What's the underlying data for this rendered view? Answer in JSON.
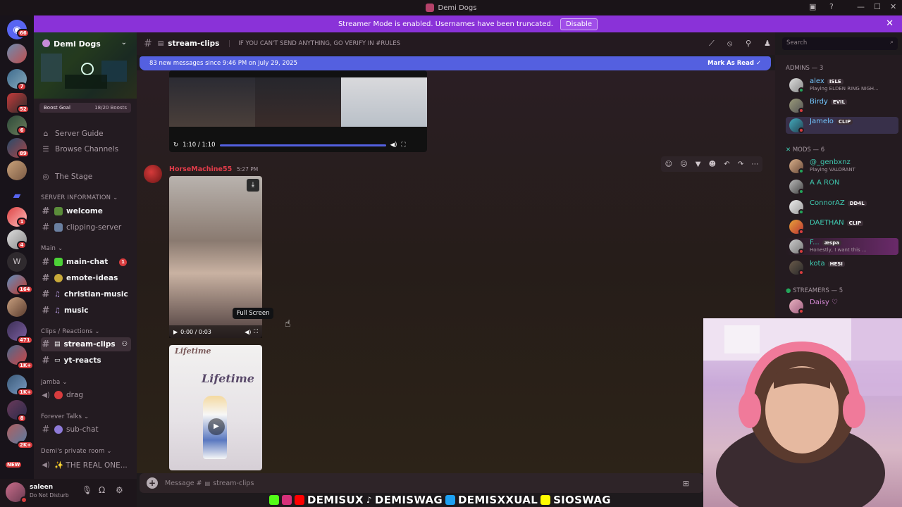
{
  "window": {
    "title": "Demi Dogs"
  },
  "banner": {
    "text": "Streamer Mode is enabled. Usernames have been truncated.",
    "button": "Disable"
  },
  "guilds": [
    {
      "badge": "66"
    },
    {
      "badge": ""
    },
    {
      "badge": "7"
    },
    {
      "badge": "52"
    },
    {
      "badge": "6"
    },
    {
      "badge": "89"
    },
    {
      "badge": ""
    },
    {
      "badge": ""
    },
    {
      "badge": "1"
    },
    {
      "badge": "4"
    },
    {
      "badge": "W"
    },
    {
      "badge": "164"
    },
    {
      "badge": ""
    },
    {
      "badge": "471"
    },
    {
      "badge": "1K+"
    },
    {
      "badge": "1K+"
    },
    {
      "badge": "8"
    },
    {
      "badge": "2K+"
    },
    {
      "badge": "NEW"
    }
  ],
  "server": {
    "name": "Demi Dogs",
    "boost_goal": "Boost Goal",
    "boost_count": "18/20 Boosts",
    "links": [
      "Server Guide",
      "Browse Channels",
      "The Stage"
    ],
    "categories": {
      "server_info": "SERVER INFORMATION",
      "main": "Main",
      "clips": "Clips / Reactions",
      "jamba": "jamba",
      "forever": "Forever Talks",
      "demi_room": "Demi's private room"
    },
    "channels": {
      "welcome": "welcome",
      "clipping": "clipping-server",
      "main_chat": "main-chat",
      "main_chat_badge": "1",
      "emote_ideas": "emote-ideas",
      "christian_music": "christian-music",
      "music": "music",
      "stream_clips": "stream-clips",
      "yt_reacts": "yt-reacts",
      "drag": "drag",
      "sub_chat": "sub-chat",
      "real_one": "✨ THE REAL ONE..."
    }
  },
  "user": {
    "name": "saleen",
    "status": "Do Not Disturb"
  },
  "chat_header": {
    "channel": "stream-clips",
    "topic": "IF YOU CAN'T SEND ANYTHING, GO VERIFY IN #RULES"
  },
  "search": {
    "placeholder": "Search"
  },
  "new_messages": {
    "text": "83 new messages since 9:46 PM on July 29, 2025",
    "mark": "Mark As Read"
  },
  "video1": {
    "time": "1:10 / 1:10"
  },
  "message": {
    "author": "HorseMachine55",
    "timestamp": "5:27 PM",
    "video_time": "0:00 / 0:03",
    "tooltip": "Full Screen",
    "overlay_text_1": "Lifetime",
    "overlay_text_2": "Lifetime"
  },
  "composer": {
    "placeholder": "Message #",
    "channel": "stream-clips"
  },
  "members": {
    "admins_label": "ADMINS — 3",
    "mods_label": "MODS — 6",
    "streamers_label": "STREAMERS — 5",
    "admins": [
      {
        "name": "alex",
        "tag": "ISLE",
        "activity": "Playing ELDEN RING NIGH...",
        "color": "#74c7ff"
      },
      {
        "name": "Birdy",
        "tag": "EVIL",
        "activity": "",
        "color": "#74c7ff"
      },
      {
        "name": "Jamelo",
        "tag": "CLIP",
        "activity": "",
        "color": "#74c7ff"
      }
    ],
    "mods": [
      {
        "name": "@_genbxnz",
        "tag": "",
        "activity": "Playing VALORANT",
        "color": "#3fc9b0"
      },
      {
        "name": "A A RON",
        "tag": "",
        "activity": "",
        "color": "#3fc9b0"
      },
      {
        "name": "ConnorAZ",
        "tag": "DD4L",
        "activity": "",
        "color": "#3fc9b0"
      },
      {
        "name": "DAETHAN",
        "tag": "CLIP",
        "activity": "",
        "color": "#3fc9b0"
      },
      {
        "name": "F...",
        "tag": "æspa",
        "activity": "Honestly, I want this ...",
        "color": "#3fc9b0"
      },
      {
        "name": "kota",
        "tag": "HESI",
        "activity": "",
        "color": "#3fc9b0"
      }
    ],
    "streamers": [
      {
        "name": "Daisy ♡",
        "color": "#d68ad6"
      }
    ]
  },
  "overlay": {
    "handles": [
      "DEMISUX",
      "DEMISWAG",
      "DEMISXXUAL",
      "SIOSWAG"
    ]
  },
  "colors": {
    "accent": "#5460e0",
    "banner": "#8a32d8",
    "dnd": "#d83c3e"
  }
}
